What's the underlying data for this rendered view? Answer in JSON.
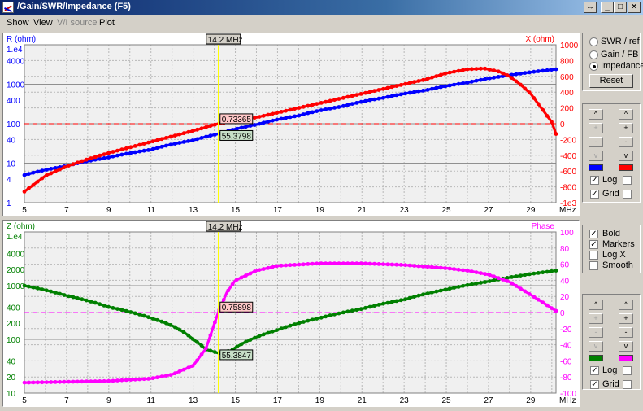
{
  "window": {
    "title": "/Gain/SWR/Impedance (F5)",
    "resize_glyph": "↔",
    "min_glyph": "_",
    "max_glyph": "□",
    "close_glyph": "×"
  },
  "menu": [
    {
      "label": "Show",
      "disabled": false
    },
    {
      "label": "View",
      "disabled": false
    },
    {
      "label": "V/I source",
      "disabled": true
    },
    {
      "label": "Plot",
      "disabled": false
    }
  ],
  "top_panel": {
    "left_axis_title": "R (ohm)",
    "right_axis_title": "X (ohm)",
    "cursor_label": "14.2 MHz",
    "marker_right_value": "0.73365",
    "marker_left_value": "55.3798",
    "left_ticks": [
      "1.e4",
      "4000",
      "1000",
      "400",
      "100",
      "40",
      "10",
      "4",
      "1"
    ],
    "right_ticks": [
      "1000",
      "800",
      "600",
      "400",
      "200",
      "0",
      "-200",
      "-400",
      "-600",
      "-800",
      "-1e3"
    ],
    "x_ticks": [
      "5",
      "7",
      "9",
      "11",
      "13",
      "15",
      "17",
      "19",
      "21",
      "23",
      "25",
      "27",
      "29"
    ],
    "x_unit": "MHz"
  },
  "bottom_panel": {
    "left_axis_title": "Z (ohm)",
    "right_axis_title": "Phase",
    "cursor_label": "14.2 MHz",
    "marker_right_value": "0.75898",
    "marker_left_value": "55.3847",
    "left_ticks": [
      "1.e4",
      "4000",
      "2000",
      "1000",
      "400",
      "200",
      "100",
      "40",
      "20",
      "10"
    ],
    "right_ticks": [
      "100",
      "80",
      "60",
      "40",
      "20",
      "0",
      "-20",
      "-40",
      "-60",
      "-80",
      "-100"
    ],
    "x_ticks": [
      "5",
      "7",
      "9",
      "11",
      "13",
      "15",
      "17",
      "19",
      "21",
      "23",
      "25",
      "27",
      "29"
    ],
    "x_unit": "MHz"
  },
  "chart_data": [
    {
      "type": "line",
      "x_range": [
        5,
        30.2
      ],
      "cursor_x": 14.2,
      "y_left": {
        "title": "R (ohm)",
        "scale": "log",
        "range": [
          1,
          10000
        ]
      },
      "y_right": {
        "title": "X (ohm)",
        "scale": "linear",
        "range": [
          -1000,
          1000
        ]
      },
      "grid": true,
      "series": [
        {
          "axis": "left",
          "color": "#0000ff",
          "points": [
            [
              5,
              5
            ],
            [
              7,
              8.5
            ],
            [
              9,
              14
            ],
            [
              11,
              22
            ],
            [
              13,
              38
            ],
            [
              14.2,
              55.38
            ],
            [
              16,
              95
            ],
            [
              18,
              160
            ],
            [
              20,
              270
            ],
            [
              22,
              450
            ],
            [
              24,
              700
            ],
            [
              26,
              1100
            ],
            [
              28,
              1700
            ],
            [
              30.2,
              2400
            ]
          ]
        },
        {
          "axis": "right",
          "color": "#ff0000",
          "points": [
            [
              5,
              -860
            ],
            [
              6,
              -660
            ],
            [
              7,
              -540
            ],
            [
              8,
              -450
            ],
            [
              9,
              -370
            ],
            [
              10,
              -300
            ],
            [
              11,
              -230
            ],
            [
              12,
              -160
            ],
            [
              13,
              -90
            ],
            [
              14.2,
              0.73
            ],
            [
              16,
              80
            ],
            [
              18,
              200
            ],
            [
              20,
              320
            ],
            [
              22,
              440
            ],
            [
              24,
              560
            ],
            [
              25,
              640
            ],
            [
              26,
              690
            ],
            [
              26.8,
              700
            ],
            [
              27.5,
              660
            ],
            [
              28,
              600
            ],
            [
              28.5,
              500
            ],
            [
              29,
              380
            ],
            [
              29.5,
              200
            ],
            [
              30,
              20
            ],
            [
              30.2,
              -130
            ]
          ]
        }
      ]
    },
    {
      "type": "line",
      "x_range": [
        5,
        30.2
      ],
      "cursor_x": 14.2,
      "y_left": {
        "title": "Z (ohm)",
        "scale": "log",
        "range": [
          10,
          10000
        ]
      },
      "y_right": {
        "title": "Phase",
        "scale": "linear",
        "range": [
          -100,
          100
        ]
      },
      "grid": true,
      "series": [
        {
          "axis": "left",
          "color": "#008000",
          "points": [
            [
              5,
              1000
            ],
            [
              7,
              650
            ],
            [
              9,
              400
            ],
            [
              11,
              250
            ],
            [
              12,
              180
            ],
            [
              13,
              100
            ],
            [
              13.6,
              65
            ],
            [
              14.2,
              55.38
            ],
            [
              14.8,
              62
            ],
            [
              15.5,
              90
            ],
            [
              17,
              150
            ],
            [
              19,
              250
            ],
            [
              21,
              370
            ],
            [
              23,
              550
            ],
            [
              25,
              850
            ],
            [
              27,
              1200
            ],
            [
              29,
              1650
            ],
            [
              30.2,
              1900
            ]
          ]
        },
        {
          "axis": "right",
          "color": "#ff00ff",
          "points": [
            [
              5,
              -87
            ],
            [
              7,
              -86
            ],
            [
              9,
              -85
            ],
            [
              11,
              -82
            ],
            [
              12,
              -77
            ],
            [
              13,
              -66
            ],
            [
              13.6,
              -45
            ],
            [
              14.2,
              0.76
            ],
            [
              14.6,
              25
            ],
            [
              15,
              40
            ],
            [
              16,
              52
            ],
            [
              17,
              58
            ],
            [
              19,
              61
            ],
            [
              21,
              61
            ],
            [
              23,
              59
            ],
            [
              25,
              55
            ],
            [
              26,
              52
            ],
            [
              27,
              47
            ],
            [
              28,
              38
            ],
            [
              29,
              22
            ],
            [
              30.2,
              2
            ]
          ]
        }
      ]
    }
  ],
  "controls": {
    "display_modes": [
      {
        "label": "SWR / ref",
        "checked": false
      },
      {
        "label": "Gain / FB",
        "checked": false
      },
      {
        "label": "Impedance",
        "checked": true
      }
    ],
    "reset_label": "Reset",
    "top_scale": {
      "buttons": [
        {
          "glyph": "^",
          "disabled": false
        },
        {
          "glyph": "^",
          "disabled": false
        },
        {
          "glyph": "+",
          "disabled": true
        },
        {
          "glyph": "+",
          "disabled": false
        },
        {
          "glyph": "-",
          "disabled": true
        },
        {
          "glyph": "-",
          "disabled": false
        },
        {
          "glyph": "v",
          "disabled": true
        },
        {
          "glyph": "v",
          "disabled": false
        }
      ],
      "left_color": "#0000ff",
      "right_color": "#ff0000",
      "log_label": "Log",
      "log_left": true,
      "log_right": false,
      "grid_label": "Grid",
      "grid_left": true,
      "grid_right": false
    },
    "options": [
      {
        "label": "Bold",
        "checked": true
      },
      {
        "label": "Markers",
        "checked": true
      },
      {
        "label": "Log X",
        "checked": false
      },
      {
        "label": "Smooth",
        "checked": false
      }
    ],
    "bottom_scale": {
      "buttons": [
        {
          "glyph": "^",
          "disabled": false
        },
        {
          "glyph": "^",
          "disabled": false
        },
        {
          "glyph": "+",
          "disabled": true
        },
        {
          "glyph": "+",
          "disabled": false
        },
        {
          "glyph": "-",
          "disabled": true
        },
        {
          "glyph": "-",
          "disabled": false
        },
        {
          "glyph": "v",
          "disabled": true
        },
        {
          "glyph": "v",
          "disabled": false
        }
      ],
      "left_color": "#008000",
      "right_color": "#ff00ff",
      "log_label": "Log",
      "log_left": true,
      "log_right": false,
      "grid_label": "Grid",
      "grid_left": true,
      "grid_right": false
    },
    "check_glyph": "✓"
  }
}
